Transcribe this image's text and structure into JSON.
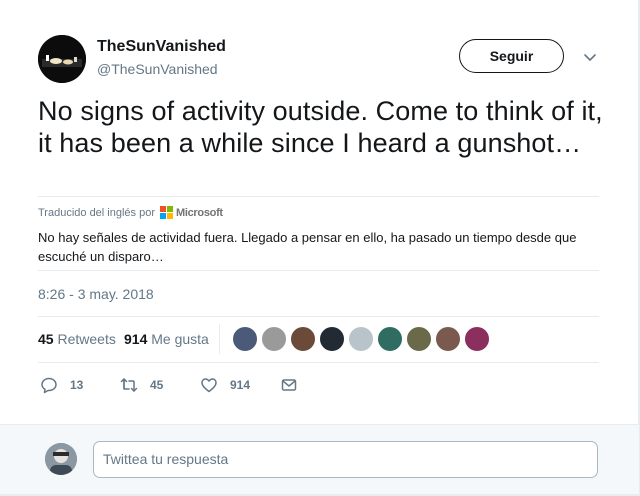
{
  "user": {
    "name": "TheSunVanished",
    "handle": "@TheSunVanished",
    "follow_label": "Seguir"
  },
  "tweet": {
    "text": "No signs of activity outside. Come to think of it, it has been a while since I heard a gunshot…",
    "translated_by": "Traducido del inglés por",
    "translator": "Microsoft",
    "translation": "No hay señales de actividad fuera. Llegado a pensar en ello, ha pasado un tiempo desde que escuché un disparo…",
    "timestamp": "8:26 - 3 may. 2018"
  },
  "stats": {
    "retweets_count": "45",
    "retweets_label": "Retweets",
    "likes_count": "914",
    "likes_label": "Me gusta"
  },
  "actions": {
    "reply_count": "13",
    "retweet_count": "45",
    "like_count": "914"
  },
  "reply": {
    "placeholder": "Twittea tu respuesta"
  },
  "icons": [
    "chevron-down-icon",
    "microsoft-logo",
    "reply-icon",
    "retweet-icon",
    "heart-icon",
    "message-icon"
  ],
  "colors": {
    "text": "#14171a",
    "secondary": "#657786",
    "border": "#e6ecf0",
    "ms_red": "#f25022",
    "ms_green": "#7fba00",
    "ms_blue": "#00a4ef",
    "ms_yellow": "#ffb900"
  }
}
